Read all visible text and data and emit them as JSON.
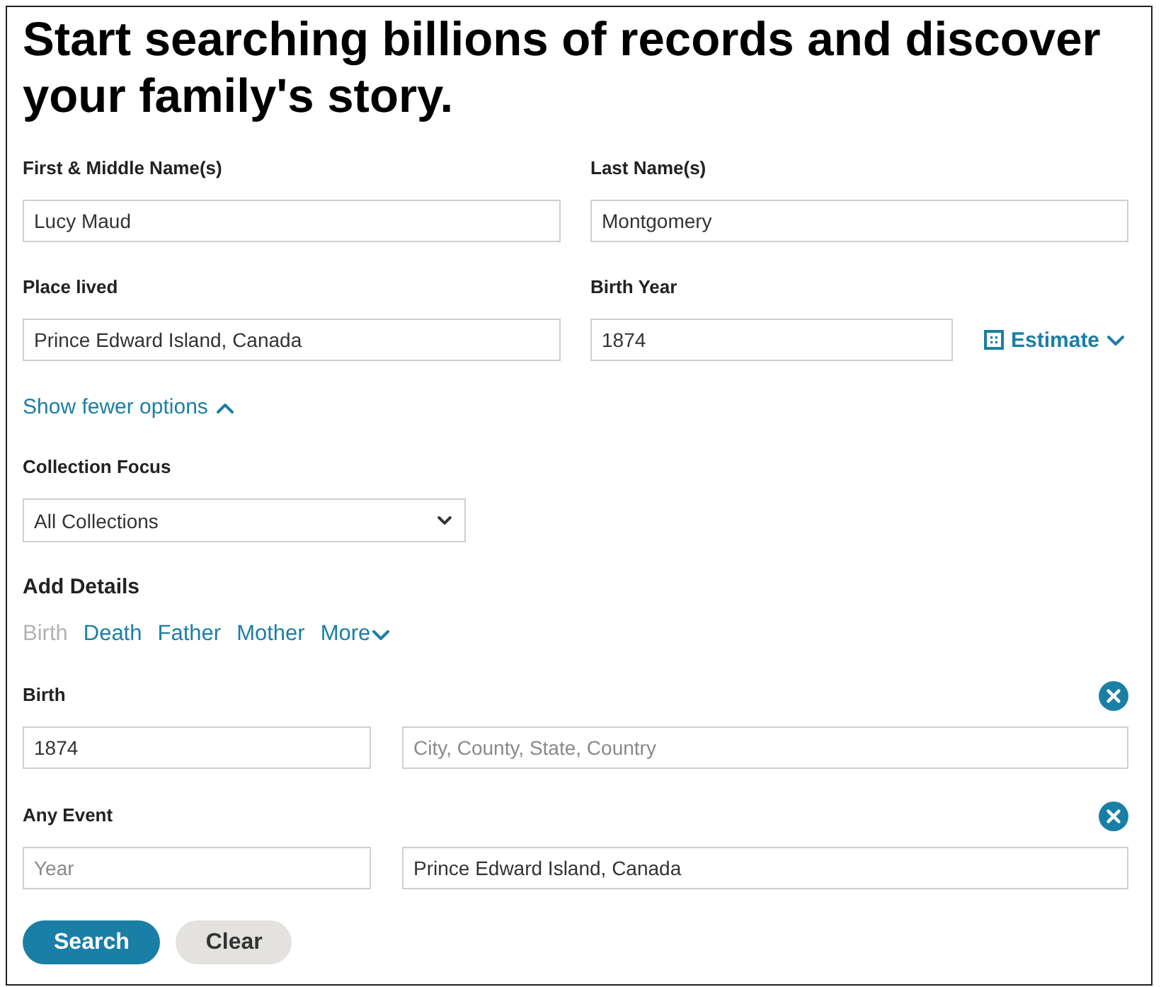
{
  "heading": "Start searching billions of records and discover your family's story.",
  "name_fields": [
    {
      "label": "First & Middle Name(s)",
      "value": "Lucy Maud"
    },
    {
      "label": "Last Name(s)",
      "value": "Montgomery"
    },
    {
      "label": "Place lived",
      "value": "Prince Edward Island, Canada"
    },
    {
      "label": "Birth Year",
      "value": "1874",
      "estimate_button": "Estimate"
    }
  ],
  "options_toggle": {
    "label": "Show fewer options",
    "expanded": true
  },
  "collection_focus": {
    "label": "Collection Focus",
    "value": "All Collections"
  },
  "add_details": {
    "title": "Add Details",
    "links": [
      {
        "label": "Birth",
        "kind": "link",
        "disabled": true
      },
      {
        "label": "Death",
        "kind": "link",
        "disabled": false
      },
      {
        "label": "Father",
        "kind": "link",
        "disabled": false
      },
      {
        "label": "Mother",
        "kind": "link",
        "disabled": false
      },
      {
        "label": "More",
        "kind": "menu",
        "disabled": false
      }
    ]
  },
  "events": [
    {
      "label": "Birth",
      "year": {
        "value": "1874"
      },
      "place": {
        "placeholder": "City, County, State, Country"
      }
    },
    {
      "label": "Any Event",
      "year": {
        "placeholder": "Year"
      },
      "place": {
        "value": "Prince Edward Island, Canada"
      }
    }
  ],
  "buttons": [
    {
      "label": "Search",
      "kind": "primary"
    },
    {
      "label": "Clear",
      "kind": "secondary"
    }
  ]
}
